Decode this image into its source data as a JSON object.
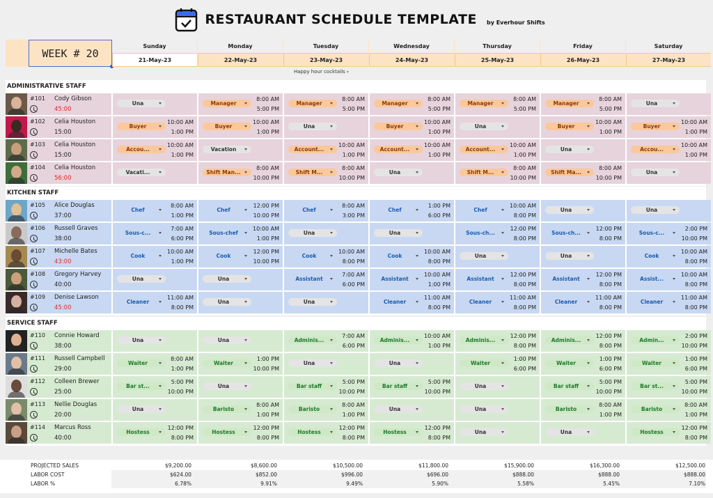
{
  "header": {
    "title": "RESTAURANT SCHEDULE TEMPLATE",
    "byline": "by Everhour Shifts",
    "week_label": "WEEK # 20",
    "note": "Happy hour cocktails"
  },
  "days": [
    {
      "name": "Sunday",
      "date": "21-May-23"
    },
    {
      "name": "Monday",
      "date": "22-May-23"
    },
    {
      "name": "Tuesday",
      "date": "23-May-23"
    },
    {
      "name": "Wednesday",
      "date": "24-May-23"
    },
    {
      "name": "Thursday",
      "date": "25-May-23"
    },
    {
      "name": "Friday",
      "date": "26-May-23"
    },
    {
      "name": "Saturday",
      "date": "27-May-23"
    }
  ],
  "sections": [
    {
      "title": "ADMINISTRATIVE STAFF",
      "theme": "admin",
      "employees": [
        {
          "id": "#101",
          "name": "Cody Gibson",
          "hours": "45:00",
          "over": true,
          "shifts": [
            {
              "role": "Una"
            },
            {
              "role": "Manager",
              "start": "8:00 AM",
              "end": "5:00 PM"
            },
            {
              "role": "Manager",
              "start": "8:00 AM",
              "end": "5:00 PM"
            },
            {
              "role": "Manager",
              "start": "8:00 AM",
              "end": "5:00 PM"
            },
            {
              "role": "Manager",
              "start": "8:00 AM",
              "end": "5:00 PM"
            },
            {
              "role": "Manager",
              "start": "8:00 AM",
              "end": "5:00 PM"
            },
            {
              "role": "Una"
            }
          ]
        },
        {
          "id": "#102",
          "name": "Celia Houston",
          "hours": "15:00",
          "over": false,
          "shifts": [
            {
              "role": "Buyer",
              "start": "10:00 AM",
              "end": "1:00 PM"
            },
            {
              "role": "Buyer",
              "start": "10:00 AM",
              "end": "1:00 PM"
            },
            {
              "role": "Una"
            },
            {
              "role": "Buyer",
              "start": "10:00 AM",
              "end": "1:00 PM"
            },
            {
              "role": "Una"
            },
            {
              "role": "Buyer",
              "start": "10:00 AM",
              "end": "1:00 PM"
            },
            {
              "role": "Buyer",
              "start": "10:00 AM",
              "end": "1:00 PM"
            }
          ]
        },
        {
          "id": "#103",
          "name": "Celia Houston",
          "hours": "15:00",
          "over": false,
          "shifts": [
            {
              "role": "Accou...",
              "start": "10:00 AM",
              "end": "1:00 PM"
            },
            {
              "role": "Vacation",
              "neutral": true
            },
            {
              "role": "Account...",
              "start": "10:00 AM",
              "end": "1:00 PM"
            },
            {
              "role": "Account...",
              "start": "10:00 AM",
              "end": "1:00 PM"
            },
            {
              "role": "Account...",
              "start": "10:00 AM",
              "end": "1:00 PM"
            },
            {
              "role": "Una"
            },
            {
              "role": "Accou...",
              "start": "10:00 AM",
              "end": "1:00 PM"
            }
          ]
        },
        {
          "id": "#104",
          "name": "Celia Houston",
          "hours": "56:00",
          "over": true,
          "shifts": [
            {
              "role": "Vacati...",
              "neutral": true
            },
            {
              "role": "Shift Man...",
              "start": "8:00 AM",
              "end": "10:00 PM"
            },
            {
              "role": "Shift M...",
              "start": "8:00 AM",
              "end": "10:00 PM"
            },
            {
              "role": "Una"
            },
            {
              "role": "Shift M...",
              "start": "8:00 AM",
              "end": "10:00 PM"
            },
            {
              "role": "Shift Ma...",
              "start": "8:00 AM",
              "end": "10:00 PM"
            },
            {
              "role": "Una"
            }
          ]
        }
      ]
    },
    {
      "title": "KITCHEN STAFF",
      "theme": "kitchen",
      "employees": [
        {
          "id": "#105",
          "name": "Alice Douglas",
          "hours": "37:00",
          "over": false,
          "shifts": [
            {
              "role": "Chef",
              "start": "8:00 AM",
              "end": "1:00 PM"
            },
            {
              "role": "Chef",
              "start": "12:00 PM",
              "end": "10:00 PM"
            },
            {
              "role": "Chef",
              "start": "8:00 AM",
              "end": "3:00 PM"
            },
            {
              "role": "Chef",
              "start": "1:00 PM",
              "end": "6:00 PM"
            },
            {
              "role": "Chef",
              "start": "10:00 AM",
              "end": "8:00 PM"
            },
            {
              "role": "Una"
            },
            {
              "role": "Una"
            }
          ]
        },
        {
          "id": "#106",
          "name": "Russell Graves",
          "hours": "38:00",
          "over": false,
          "shifts": [
            {
              "role": "Sous-c...",
              "start": "7:00 AM",
              "end": "6:00 PM"
            },
            {
              "role": "Sous-chef",
              "start": "10:00 AM",
              "end": "1:00 PM"
            },
            {
              "role": "Una"
            },
            {
              "role": "Una"
            },
            {
              "role": "Sous-ch...",
              "start": "12:00 PM",
              "end": "8:00 PM"
            },
            {
              "role": "Sous-ch...",
              "start": "12:00 PM",
              "end": "8:00 PM"
            },
            {
              "role": "Sous-c...",
              "start": "2:00 PM",
              "end": "10:00 PM"
            }
          ]
        },
        {
          "id": "#107",
          "name": "Michelle Bates",
          "hours": "43:00",
          "over": true,
          "shifts": [
            {
              "role": "Cook",
              "start": "10:00 AM",
              "end": "1:00 PM"
            },
            {
              "role": "Cook",
              "start": "12:00 PM",
              "end": "10:00 PM"
            },
            {
              "role": "Cook",
              "start": "10:00 AM",
              "end": "8:00 PM"
            },
            {
              "role": "Cook",
              "start": "10:00 AM",
              "end": "8:00 PM"
            },
            {
              "role": "Una"
            },
            {
              "role": "Una"
            },
            {
              "role": "Cook",
              "start": "10:00 AM",
              "end": "8:00 PM"
            }
          ]
        },
        {
          "id": "#108",
          "name": "Gregory Harvey",
          "hours": "40:00",
          "over": false,
          "shifts": [
            {
              "role": "Una"
            },
            {
              "role": "Una"
            },
            {
              "role": "Assistant",
              "start": "7:00 AM",
              "end": "6:00 PM"
            },
            {
              "role": "Assistant",
              "start": "10:00 AM",
              "end": "1:00 PM"
            },
            {
              "role": "Assistant",
              "start": "12:00 PM",
              "end": "8:00 PM"
            },
            {
              "role": "Assistant",
              "start": "12:00 PM",
              "end": "8:00 PM"
            },
            {
              "role": "Assist...",
              "start": "10:00 AM",
              "end": "8:00 PM"
            }
          ]
        },
        {
          "id": "#109",
          "name": "Denise Lawson",
          "hours": "45:00",
          "over": true,
          "shifts": [
            {
              "role": "Cleaner",
              "start": "11:00 AM",
              "end": "8:00 PM"
            },
            {
              "role": "Una"
            },
            {
              "role": "Una"
            },
            {
              "role": "Cleaner",
              "start": "11:00 AM",
              "end": "8:00 PM"
            },
            {
              "role": "Cleaner",
              "start": "11:00 AM",
              "end": "8:00 PM"
            },
            {
              "role": "Cleaner",
              "start": "11:00 AM",
              "end": "8:00 PM"
            },
            {
              "role": "Cleaner",
              "start": "11:00 AM",
              "end": "8:00 PM"
            }
          ]
        }
      ]
    },
    {
      "title": "SERVICE STAFF",
      "theme": "service",
      "employees": [
        {
          "id": "#110",
          "name": "Connie Howard",
          "hours": "38:00",
          "over": false,
          "shifts": [
            {
              "role": "Una"
            },
            {
              "role": "Una"
            },
            {
              "role": "Adminis...",
              "start": "7:00 AM",
              "end": "6:00 PM"
            },
            {
              "role": "Adminis...",
              "start": "10:00 AM",
              "end": "1:00 PM"
            },
            {
              "role": "Adminis...",
              "start": "12:00 PM",
              "end": "8:00 PM"
            },
            {
              "role": "Adminis...",
              "start": "12:00 PM",
              "end": "8:00 PM"
            },
            {
              "role": "Admin...",
              "start": "2:00 PM",
              "end": "10:00 PM"
            }
          ]
        },
        {
          "id": "#111",
          "name": "Russell Campbell",
          "hours": "29:00",
          "over": false,
          "shifts": [
            {
              "role": "Waiter",
              "start": "8:00 AM",
              "end": "1:00 PM"
            },
            {
              "role": "Waiter",
              "start": "1:00 PM",
              "end": "10:00 PM"
            },
            {
              "role": "Una"
            },
            {
              "role": "Una"
            },
            {
              "role": "Waiter",
              "start": "1:00 PM",
              "end": "6:00 PM"
            },
            {
              "role": "Waiter",
              "start": "1:00 PM",
              "end": "6:00 PM"
            },
            {
              "role": "Waiter",
              "start": "1:00 PM",
              "end": "6:00 PM"
            }
          ]
        },
        {
          "id": "#112",
          "name": "Colleen Brewer",
          "hours": "25:00",
          "over": false,
          "shifts": [
            {
              "role": "Bar st...",
              "start": "5:00 PM",
              "end": "10:00 PM"
            },
            {
              "role": "Una"
            },
            {
              "role": "Bar staff",
              "start": "5:00 PM",
              "end": "10:00 PM"
            },
            {
              "role": "Bar staff",
              "start": "5:00 PM",
              "end": "10:00 PM"
            },
            {
              "role": "Una"
            },
            {
              "role": "Bar staff",
              "start": "5:00 PM",
              "end": "10:00 PM"
            },
            {
              "role": "Bar st...",
              "start": "5:00 PM",
              "end": "10:00 PM"
            }
          ]
        },
        {
          "id": "#113",
          "name": "Nellie Douglas",
          "hours": "20:00",
          "over": false,
          "shifts": [
            {
              "role": "Una"
            },
            {
              "role": "Baristo",
              "start": "8:00 AM",
              "end": "1:00 PM"
            },
            {
              "role": "Baristo",
              "start": "8:00 AM",
              "end": "1:00 PM"
            },
            {
              "role": "Una"
            },
            {
              "role": "Una"
            },
            {
              "role": "Baristo",
              "start": "8:00 AM",
              "end": "1:00 PM"
            },
            {
              "role": "Baristo",
              "start": "8:00 AM",
              "end": "1:00 PM"
            }
          ]
        },
        {
          "id": "#114",
          "name": "Marcus Ross",
          "hours": "40:00",
          "over": false,
          "shifts": [
            {
              "role": "Hostess",
              "start": "12:00 PM",
              "end": "8:00 PM"
            },
            {
              "role": "Hostess",
              "start": "12:00 PM",
              "end": "8:00 PM"
            },
            {
              "role": "Hostess",
              "start": "12:00 PM",
              "end": "8:00 PM"
            },
            {
              "role": "Hostess",
              "start": "12:00 PM",
              "end": "8:00 PM"
            },
            {
              "role": "Una"
            },
            {
              "role": "Una"
            },
            {
              "role": "Hostess",
              "start": "12:00 PM",
              "end": "8:00 PM"
            }
          ]
        }
      ]
    }
  ],
  "totals": [
    {
      "label": "PROJECTED SALES",
      "values": [
        "$9,200.00",
        "$8,600.00",
        "$10,500.00",
        "$11,800.00",
        "$15,900.00",
        "$16,300.00",
        "$12,500.00"
      ]
    },
    {
      "label": "LABOR COST",
      "values": [
        "$624.00",
        "$852.00",
        "$996.00",
        "$696.00",
        "$888.00",
        "$888.00",
        "$888.00"
      ]
    },
    {
      "label": "LABOR %",
      "values": [
        "6.78%",
        "9.91%",
        "9.49%",
        "5.90%",
        "5.58%",
        "5.45%",
        "7.10%"
      ]
    }
  ],
  "colors": {
    "header_peach": "#fce3c3",
    "admin_bg": "#e7d3dc",
    "kitchen_bg": "#c8d8f2",
    "service_bg": "#d6ead1",
    "over_hours": "#e2262b",
    "calendar_blue": "#3a6ee8"
  }
}
